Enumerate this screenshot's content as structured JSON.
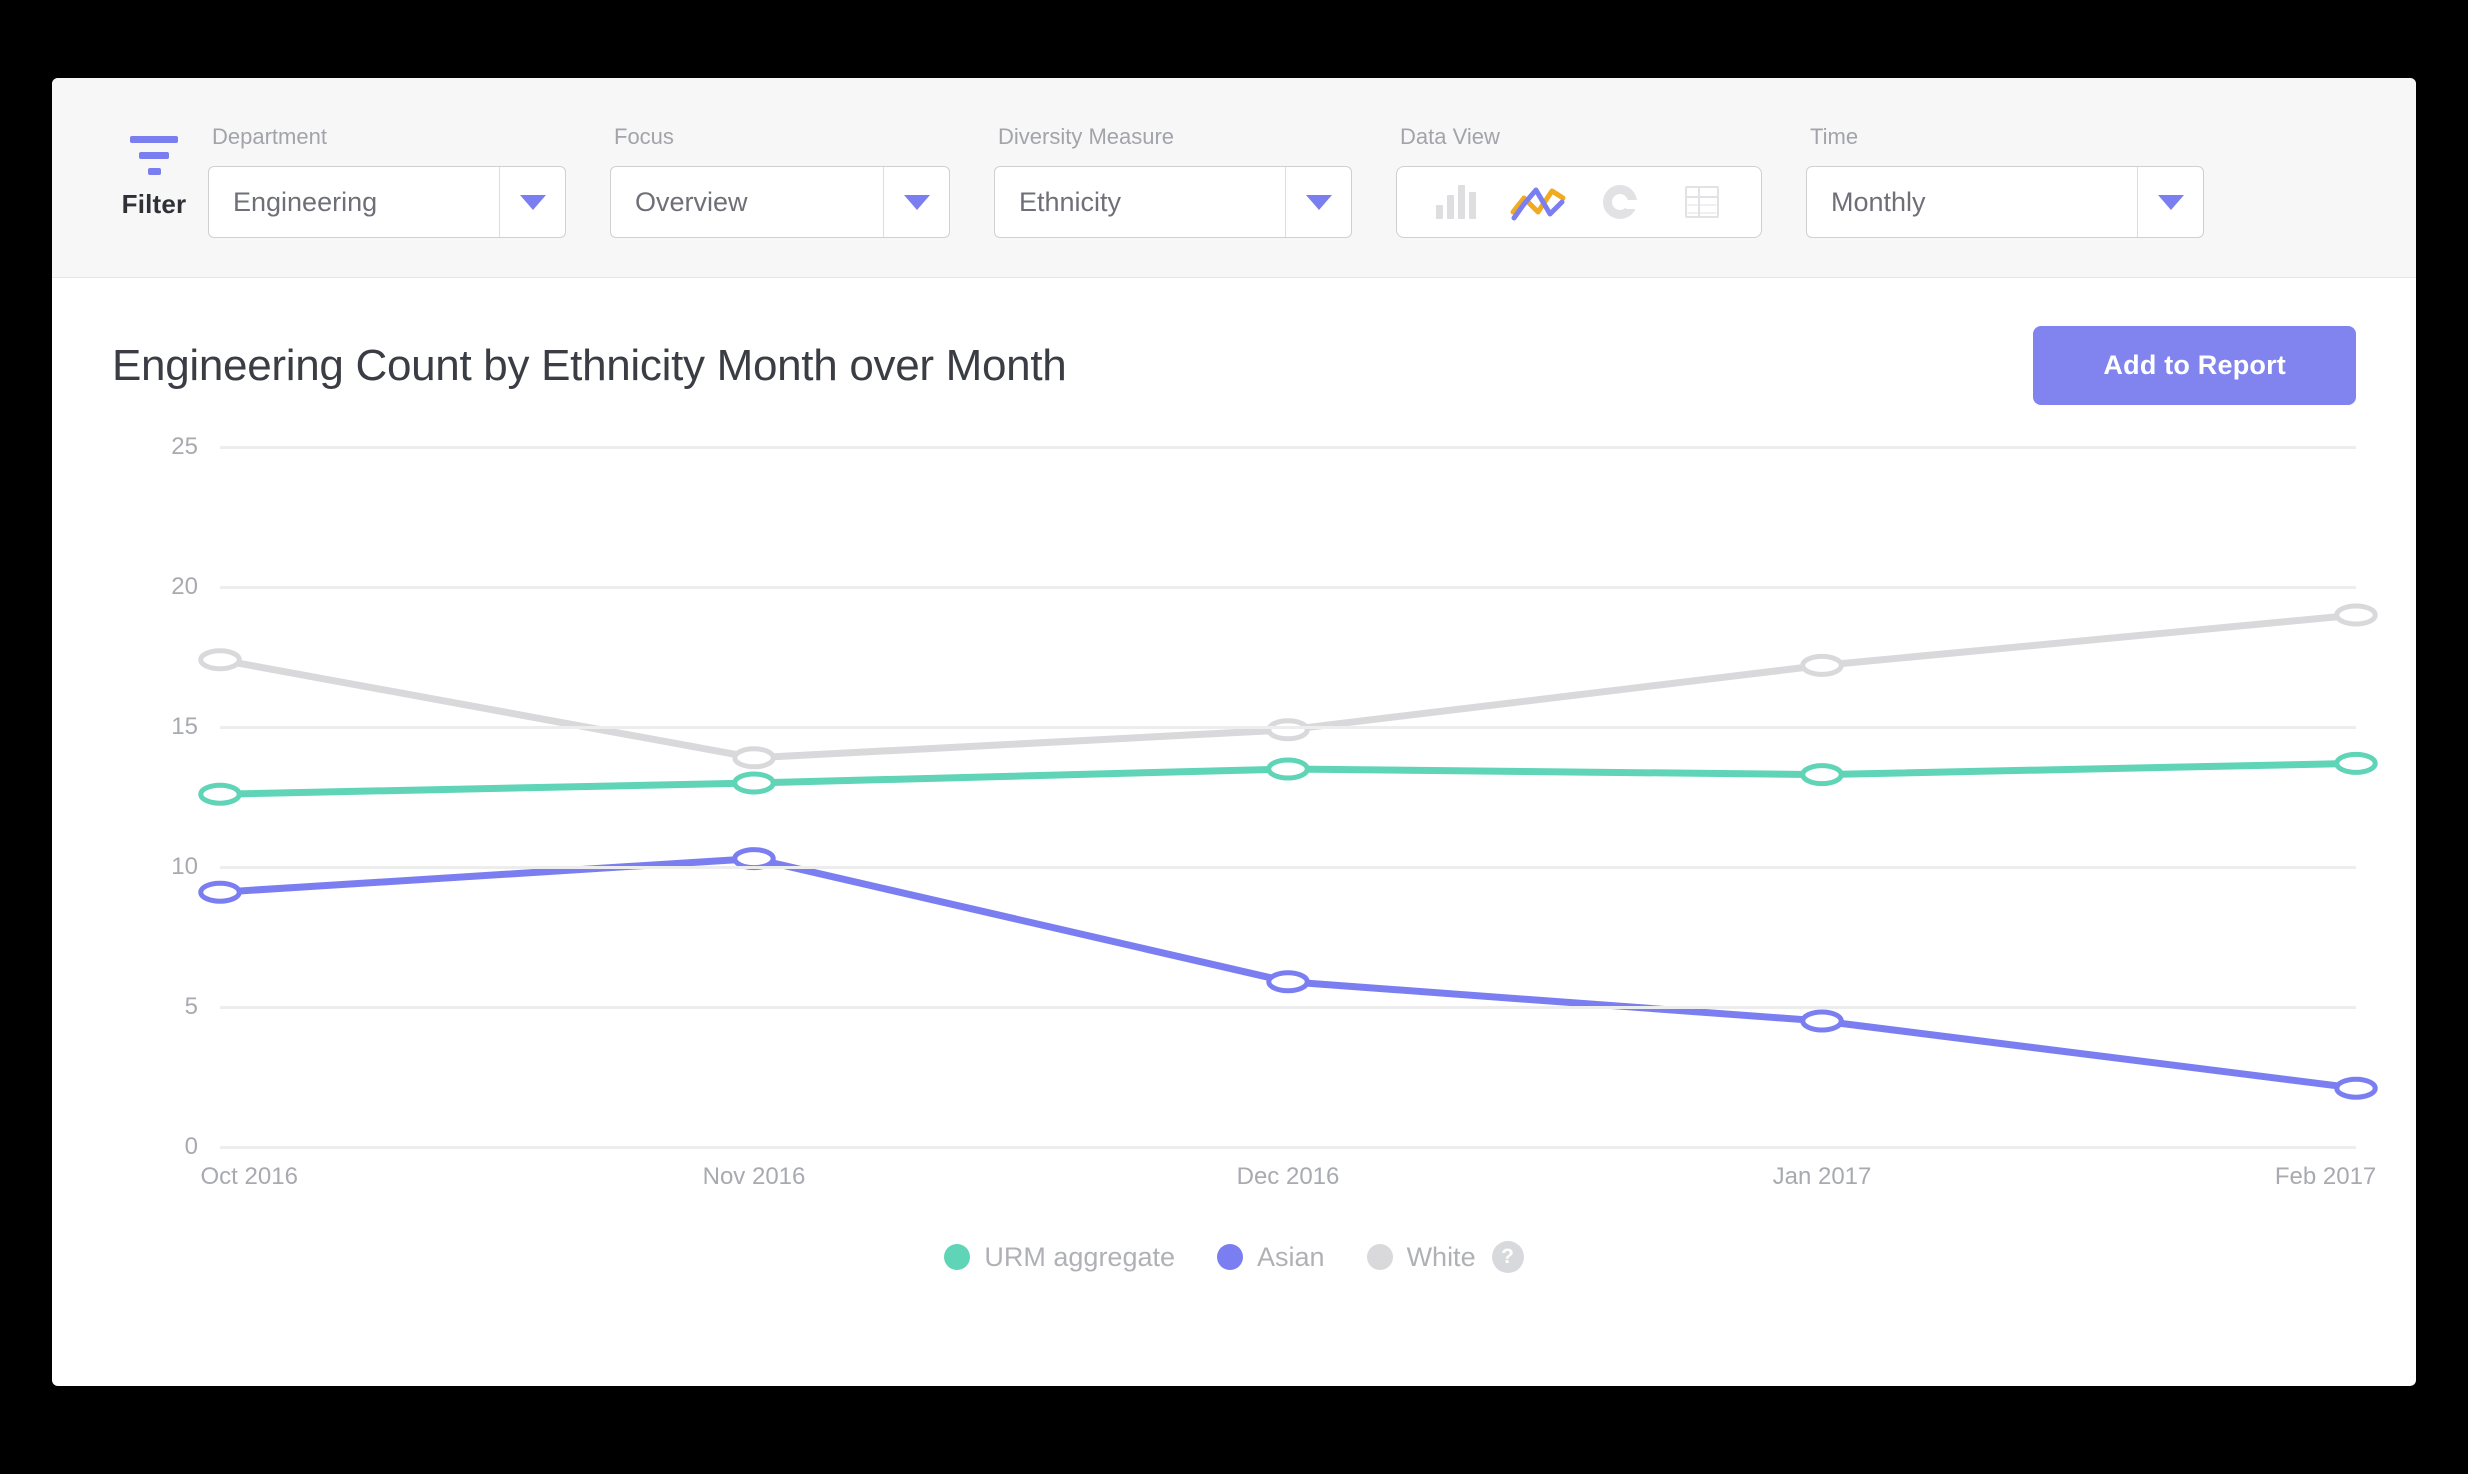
{
  "filter": {
    "caption": "Filter",
    "icon": "filter-icon",
    "fields": [
      {
        "label": "Department",
        "value": "Engineering",
        "name": "department"
      },
      {
        "label": "Focus",
        "value": "Overview",
        "name": "focus"
      },
      {
        "label": "Diversity Measure",
        "value": "Ethnicity",
        "name": "diversity-measure"
      }
    ],
    "data_view": {
      "label": "Data View",
      "options": [
        {
          "icon": "bar-chart-icon",
          "active": false
        },
        {
          "icon": "line-chart-icon",
          "active": true
        },
        {
          "icon": "donut-chart-icon",
          "active": false
        },
        {
          "icon": "table-view-icon",
          "active": false
        }
      ]
    },
    "time": {
      "label": "Time",
      "value": "Monthly"
    }
  },
  "main": {
    "title": "Engineering Count by Ethnicity Month over Month",
    "add_to_report_label": "Add to Report",
    "help_badge": "?",
    "accent_color": "#8184ee"
  },
  "chart_data": {
    "type": "line",
    "title": "Engineering Count by Ethnicity Month over Month",
    "xlabel": "",
    "ylabel": "",
    "categories": [
      "Oct 2016",
      "Nov 2016",
      "Dec 2016",
      "Jan 2017",
      "Feb 2017"
    ],
    "ylim": [
      0,
      25
    ],
    "yticks": [
      0,
      5,
      10,
      15,
      20,
      25
    ],
    "grid": true,
    "legend_position": "bottom",
    "series": [
      {
        "name": "URM aggregate",
        "color": "#5fd4b6",
        "values": [
          12.6,
          13.0,
          13.5,
          13.3,
          13.7
        ]
      },
      {
        "name": "Asian",
        "color": "#7b7ef0",
        "values": [
          9.1,
          10.3,
          5.9,
          4.5,
          2.1
        ]
      },
      {
        "name": "White",
        "color": "#d9d9dc",
        "values": [
          17.4,
          13.9,
          14.9,
          17.2,
          19.0
        ]
      }
    ]
  }
}
